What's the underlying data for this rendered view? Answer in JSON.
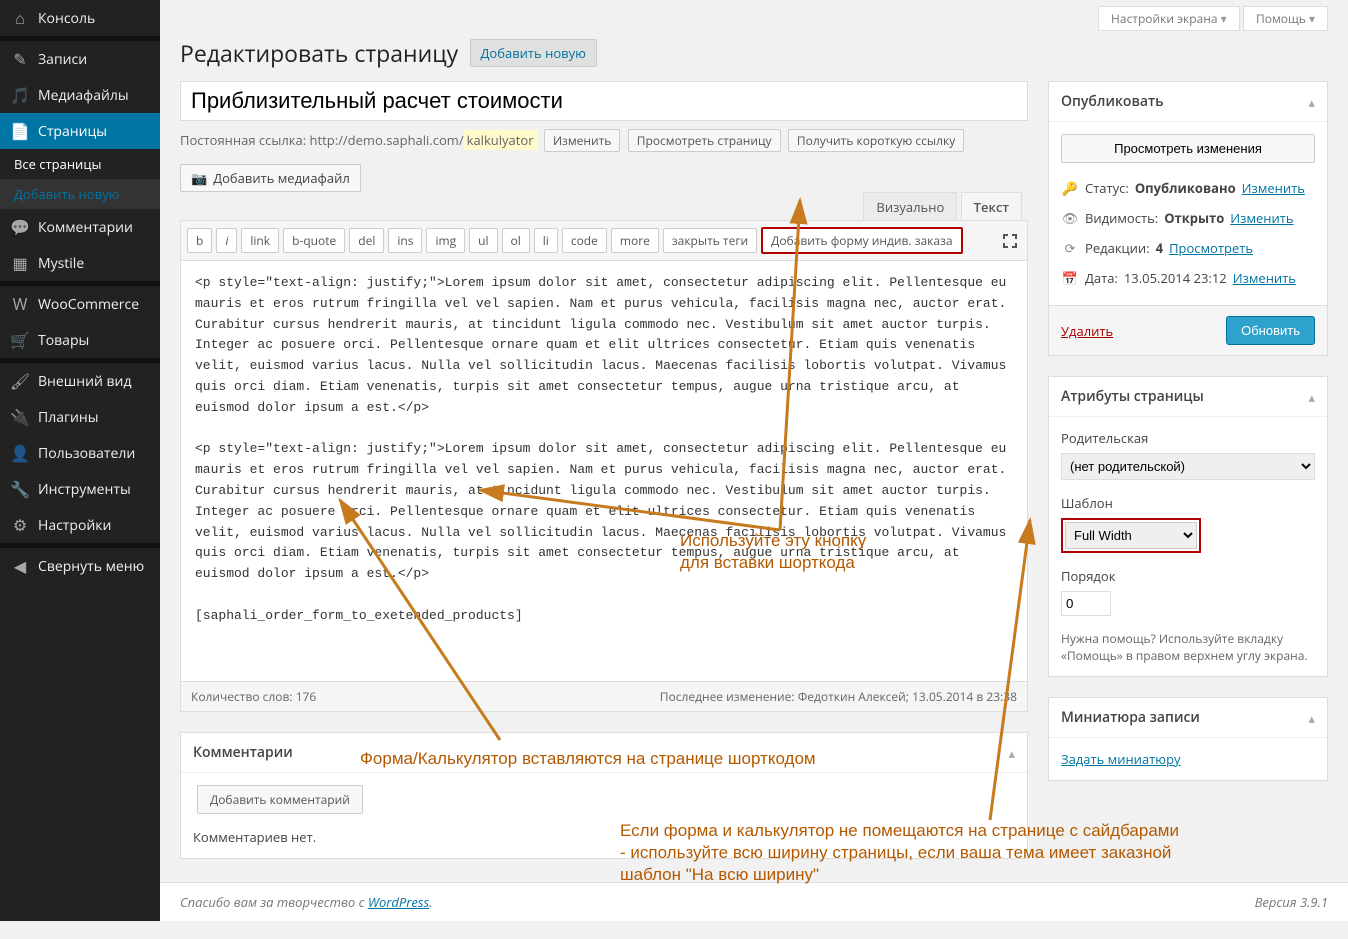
{
  "sidebar": {
    "items": [
      {
        "label": "Консоль",
        "icon": "dashboard"
      },
      {
        "label": "Записи",
        "icon": "pin"
      },
      {
        "label": "Медиафайлы",
        "icon": "media"
      },
      {
        "label": "Страницы",
        "icon": "page",
        "current": true
      },
      {
        "label": "Комментарии",
        "icon": "comment"
      },
      {
        "label": "Mystile",
        "icon": "theme"
      },
      {
        "label": "WooCommerce",
        "icon": "woo"
      },
      {
        "label": "Товары",
        "icon": "products"
      },
      {
        "label": "Внешний вид",
        "icon": "appearance"
      },
      {
        "label": "Плагины",
        "icon": "plugins"
      },
      {
        "label": "Пользователи",
        "icon": "users"
      },
      {
        "label": "Инструменты",
        "icon": "tools"
      },
      {
        "label": "Настройки",
        "icon": "settings"
      },
      {
        "label": "Свернуть меню",
        "icon": "collapse"
      }
    ],
    "submenu": [
      {
        "label": "Все страницы",
        "current": true
      },
      {
        "label": "Добавить новую"
      }
    ]
  },
  "topbar": {
    "screen_options": "Настройки экрана",
    "help": "Помощь"
  },
  "header": {
    "title": "Редактировать страницу",
    "add_new": "Добавить новую"
  },
  "title_input": "Приблизительный расчет стоимости",
  "permalink": {
    "label": "Постоянная ссылка:",
    "base": "http://demo.saphali.com/",
    "slug": "kalkulyator",
    "edit": "Изменить",
    "view_page": "Просмотреть страницу",
    "get_shortlink": "Получить короткую ссылку"
  },
  "media_button": "Добавить медиафайл",
  "editor_tabs": {
    "visual": "Визуально",
    "text": "Текст"
  },
  "quicktags": [
    "b",
    "i",
    "link",
    "b-quote",
    "del",
    "ins",
    "img",
    "ul",
    "ol",
    "li",
    "code",
    "more",
    "закрыть теги",
    "Добавить форму индив. заказа"
  ],
  "editor_content": "<p style=\"text-align: justify;\">Lorem ipsum dolor sit amet, consectetur adipiscing elit. Pellentesque eu mauris et eros rutrum fringilla vel vel sapien. Nam et purus vehicula, facilisis magna nec, auctor erat. Curabitur cursus hendrerit mauris, at tincidunt ligula commodo nec. Vestibulum sit amet auctor turpis. Integer ac posuere orci. Pellentesque ornare quam et elit ultrices consectetur. Etiam quis venenatis velit, euismod varius lacus. Nulla vel sollicitudin lacus. Maecenas facilisis lobortis volutpat. Vivamus quis orci diam. Etiam venenatis, turpis sit amet consectetur tempus, augue urna tristique arcu, at euismod dolor ipsum a est.</p>\n\n<p style=\"text-align: justify;\">Lorem ipsum dolor sit amet, consectetur adipiscing elit. Pellentesque eu mauris et eros rutrum fringilla vel vel sapien. Nam et purus vehicula, facilisis magna nec, auctor erat. Curabitur cursus hendrerit mauris, at tincidunt ligula commodo nec. Vestibulum sit amet auctor turpis. Integer ac posuere orci. Pellentesque ornare quam et elit ultrices consectetur. Etiam quis venenatis velit, euismod varius lacus. Nulla vel sollicitudin lacus. Maecenas facilisis lobortis volutpat. Vivamus quis orci diam. Etiam venenatis, turpis sit amet consectetur tempus, augue urna tristique arcu, at euismod dolor ipsum a est.</p>\n\n[saphali_order_form_to_exetended_products]",
  "editor_status": {
    "word_count_label": "Количество слов:",
    "word_count": "176",
    "last_edit": "Последнее изменение: Федоткин Алексей; 13.05.2014 в 23:38"
  },
  "comments_box": {
    "title": "Комментарии",
    "add_button": "Добавить комментарий",
    "empty": "Комментариев нет."
  },
  "publish": {
    "title": "Опубликовать",
    "preview": "Просмотреть изменения",
    "status_label": "Статус:",
    "status_value": "Опубликовано",
    "visibility_label": "Видимость:",
    "visibility_value": "Открыто",
    "revisions_label": "Редакции:",
    "revisions_count": "4",
    "revisions_browse": "Просмотреть",
    "date_label": "Дата:",
    "date_value": "13.05.2014 23:12",
    "edit": "Изменить",
    "delete": "Удалить",
    "update": "Обновить"
  },
  "attributes": {
    "title": "Атрибуты страницы",
    "parent_label": "Родительская",
    "parent_value": "(нет родительской)",
    "template_label": "Шаблон",
    "template_value": "Full Width",
    "order_label": "Порядок",
    "order_value": "0",
    "help_text": "Нужна помощь? Используйте вкладку «Помощь» в правом верхнем углу экрана."
  },
  "thumbnail": {
    "title": "Миниатюра записи",
    "set_link": "Задать миниатюру"
  },
  "footer": {
    "thanks": "Спасибо вам за творчество с ",
    "wp": "WordPress",
    "version": "Версия 3.9.1"
  },
  "annotations": {
    "btn_hint": "Используйте эту кнопку\nдля вставки шорткода",
    "shortcode_hint": "Форма/Калькулятор вставляются на странице шорткодом",
    "template_hint": "Если форма и калькулятор не помещаются на  странице с сайдбарами - используйте всю ширину страницы, если ваша тема имеет заказной шаблон \"На всю ширину\""
  }
}
